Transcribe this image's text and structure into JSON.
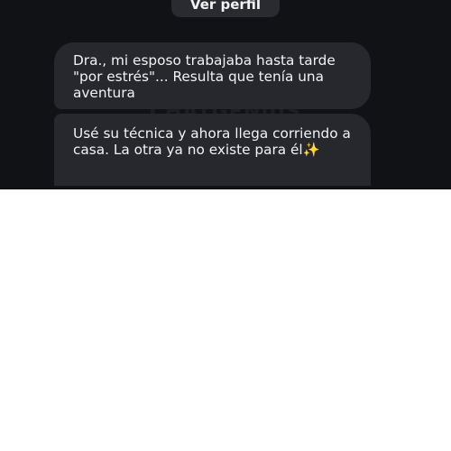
{
  "header": {
    "profile_button_label": "Ver perfil"
  },
  "watermark": {
    "text": "CHATGENIUS"
  },
  "messages": [
    {
      "text": "Dra., mi esposo trabajaba hasta tarde \"por estrés\"... Resulta que tenía una aventura"
    },
    {
      "text": "Usé su técnica y ahora llega corriendo a casa. La otra ya no existe para él",
      "emoji": "✨"
    }
  ],
  "colors": {
    "background": "#111216",
    "bubble": "#27282d",
    "text": "#f2f2f4",
    "page": "#ffffff"
  }
}
